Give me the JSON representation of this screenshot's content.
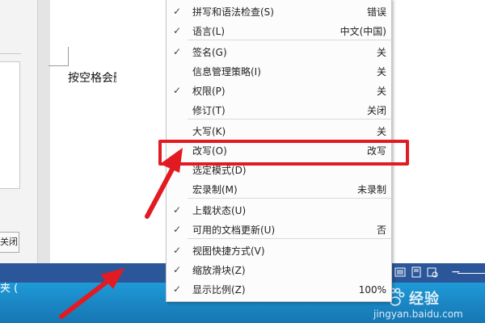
{
  "left_pane": {
    "close_button_label": "关闭"
  },
  "document": {
    "body_text": "按空格会删除"
  },
  "context_menu": {
    "items": [
      {
        "label": "拼写和语法检查(S)",
        "value": "错误",
        "checked": true
      },
      {
        "label": "语言(L)",
        "value": "中文(中国)",
        "checked": true
      },
      {
        "label": "签名(G)",
        "value": "关",
        "checked": true
      },
      {
        "label": "信息管理策略(I)",
        "value": "关",
        "checked": false
      },
      {
        "label": "权限(P)",
        "value": "关",
        "checked": true
      },
      {
        "label": "修订(T)",
        "value": "关闭",
        "checked": false
      },
      {
        "label": "大写(K)",
        "value": "关",
        "checked": false
      },
      {
        "label": "改写(O)",
        "value": "改写",
        "checked": false
      },
      {
        "label": "选定模式(D)",
        "value": "",
        "checked": false
      },
      {
        "label": "宏录制(M)",
        "value": "未录制",
        "checked": false
      },
      {
        "label": "上载状态(U)",
        "value": "",
        "checked": true
      },
      {
        "label": "可用的文档更新(U)",
        "value": "否",
        "checked": true
      },
      {
        "label": "视图快捷方式(V)",
        "value": "",
        "checked": true
      },
      {
        "label": "缩放滑块(Z)",
        "value": "",
        "checked": true
      },
      {
        "label": "显示比例(Z)",
        "value": "100%",
        "checked": true
      }
    ],
    "check_glyph": "✓"
  },
  "taskbar": {
    "text": "夹 ("
  },
  "watermark": {
    "title": "经验",
    "url": "jingyan.baidu.com"
  },
  "colors": {
    "status_bar": "#2b579a",
    "annotation_red": "#e21b22",
    "taskbar": "#1a87c4"
  }
}
